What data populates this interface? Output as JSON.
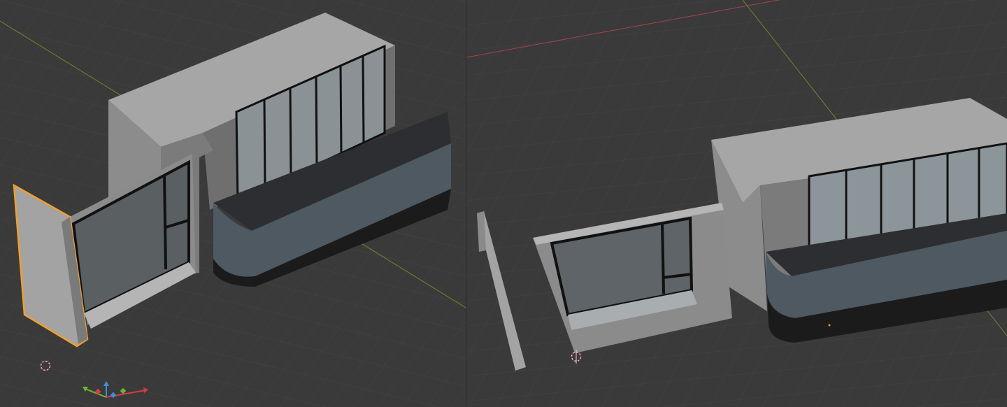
{
  "viewports": [
    {
      "name": "left-viewport",
      "selected_object": "wall-panel",
      "selection_color": "#f0a030"
    },
    {
      "name": "right-viewport"
    }
  ],
  "colors": {
    "background": "#3a3a3a",
    "grid": "#464646",
    "axis_x": "#b34a5e",
    "axis_y": "#7a9a2e",
    "wall_light": "#a9a9a9",
    "wall_mid": "#8a8a8a",
    "wall_dark": "#6e6e6e",
    "glass": "#8c969a",
    "glass_dark": "#555c60",
    "frame": "#111111",
    "counter_top": "#2b2d30",
    "counter_front": "#4d5860",
    "counter_base": "#1a1a1a",
    "selection": "#f0a030"
  },
  "icons": [
    "3d-cursor-icon",
    "gizmo-axes-icon"
  ]
}
